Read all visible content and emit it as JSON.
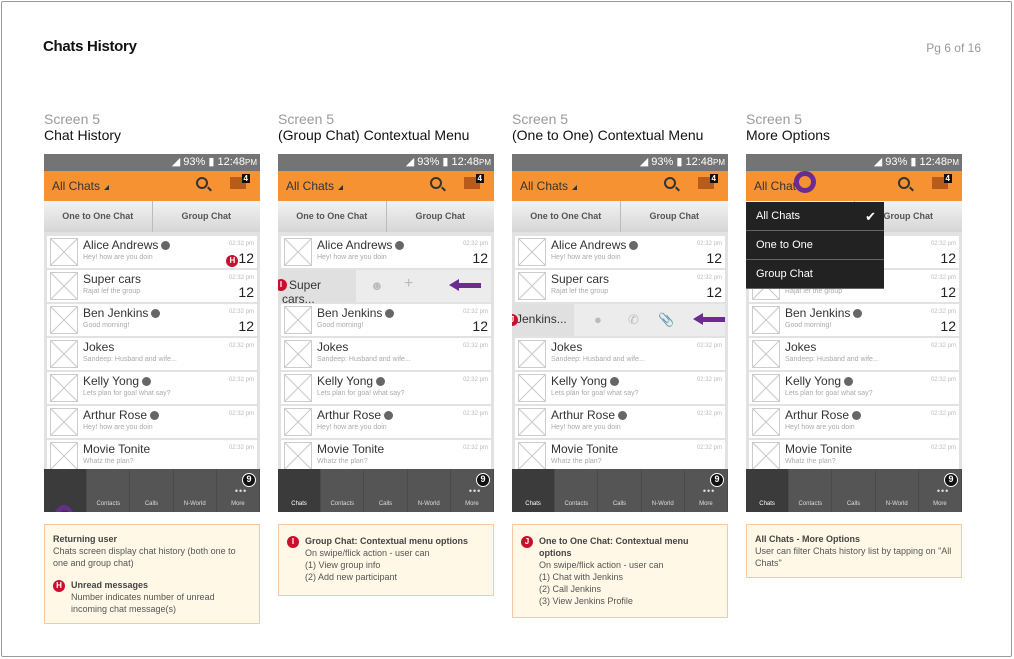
{
  "page": {
    "title": "Chats History",
    "page_num": "Pg 6 of 16"
  },
  "phone": {
    "signal": "93%",
    "time": "12:48",
    "ampm": "PM",
    "filter": "All Chats",
    "msg_badge": "4",
    "tab1": "One to One Chat",
    "tab2": "Group Chat",
    "nav": [
      "Chats",
      "Contacts",
      "Calls",
      "N-World",
      "More"
    ],
    "more_badge": "9"
  },
  "chats": [
    {
      "name": "Alice Andrews",
      "preview": "Hey! how are you doin",
      "time": "02:32 pm",
      "count": "12",
      "verified": true
    },
    {
      "name": "Super cars",
      "preview": "Rajat lef the group",
      "time": "02:32 pm",
      "count": "12",
      "verified": false
    },
    {
      "name": "Ben Jenkins",
      "preview": "Good morning!",
      "time": "02:32 pm",
      "count": "12",
      "verified": true
    },
    {
      "name": "Jokes",
      "preview": "Sandeep: Husband and wife...",
      "time": "02:32 pm",
      "count": "",
      "verified": false
    },
    {
      "name": "Kelly Yong",
      "preview": "Lets plan for goa! what say?",
      "time": "02:32 pm",
      "count": "",
      "verified": true
    },
    {
      "name": "Arthur Rose",
      "preview": "Hey! how are you doin",
      "time": "02:32 pm",
      "count": "",
      "verified": true
    },
    {
      "name": "Movie Tonite",
      "preview": "Whatz the plan?",
      "time": "02:32 pm",
      "count": "",
      "verified": false
    }
  ],
  "screens": [
    {
      "label": "Screen 5",
      "title": "Chat History"
    },
    {
      "label": "Screen 5",
      "title": "(Group Chat) Contextual Menu",
      "swipe_name": "Super cars..."
    },
    {
      "label": "Screen 5",
      "title": "(One to One) Contextual Menu",
      "swipe_name": "Jenkins..."
    },
    {
      "label": "Screen 5",
      "title": "More Options"
    }
  ],
  "menu": {
    "items": [
      "All Chats",
      "One to One",
      "Group Chat"
    ],
    "selected": "All Chats",
    "trunc": "All Chat"
  },
  "notes": {
    "n1": {
      "title": "Returning user",
      "body": "Chats screen display chat history (both one to one and group chat)",
      "badge": "H",
      "sub_title": "Unread messages",
      "sub_body": "Number indicates number of unread incoming chat message(s)"
    },
    "n2": {
      "badge": "I",
      "title": "Group Chat: Contextual menu options",
      "lines": [
        "On swipe/flick action - user can",
        "(1) View group info",
        "(2) Add new participant"
      ]
    },
    "n3": {
      "badge": "J",
      "title": "One to One Chat: Contextual menu options",
      "lines": [
        "On swipe/flick action - user can",
        "(1) Chat with Jenkins",
        "(2) Call Jenkins",
        "(3) View Jenkins Profile"
      ]
    },
    "n4": {
      "title": "All Chats - More Options",
      "body": "User can filter Chats history list by tapping on \"All Chats\""
    }
  }
}
